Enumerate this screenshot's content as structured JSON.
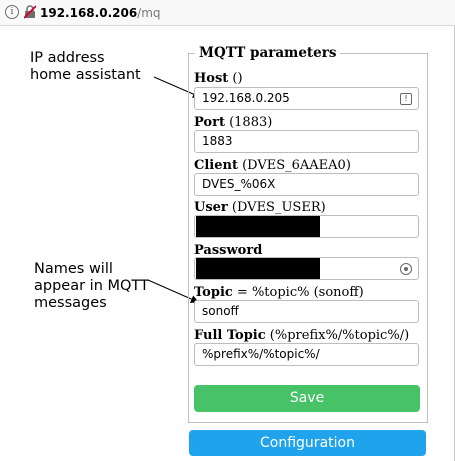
{
  "browser": {
    "url_host": "192.168.0.206",
    "url_path": "/mq"
  },
  "annotations": {
    "ip_line1": "IP address",
    "ip_line2": "home assistant",
    "names_line1": "Names will",
    "names_line2": "appear in MQTT",
    "names_line3": "messages"
  },
  "form": {
    "legend": "MQTT parameters",
    "host_label": "Host",
    "host_hint": " ()",
    "host_value": "192.168.0.205",
    "port_label": "Port",
    "port_hint": " (1883)",
    "port_value": "1883",
    "client_label": "Client",
    "client_hint": " (DVES_6AAEA0)",
    "client_value": "DVES_%06X",
    "user_label": "User",
    "user_hint": " (DVES_USER)",
    "password_label": "Password",
    "topic_label": "Topic",
    "topic_hint": " = %topic% (sonoff)",
    "topic_value": "sonoff",
    "fulltopic_label": "Full Topic",
    "fulltopic_hint": " (%prefix%/%topic%/)",
    "fulltopic_value": "%prefix%/%topic%/"
  },
  "buttons": {
    "save": "Save",
    "configuration": "Configuration"
  },
  "colors": {
    "save": "#47c266",
    "configuration": "#1fa3ec"
  }
}
